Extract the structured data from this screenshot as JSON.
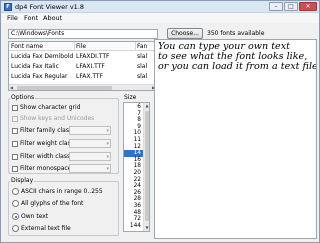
{
  "window": {
    "title": "dp4 Font Viewer v1.8",
    "icon": "app-font-icon"
  },
  "titlebar_buttons": {
    "minimize": "–",
    "maximize": "□",
    "close": "✕"
  },
  "menu": [
    "File",
    "Font",
    "About"
  ],
  "path": {
    "value": "C:\\Windows\\Fonts"
  },
  "choose_button": "Choose...",
  "fonts_available": "350 fonts available",
  "font_list": {
    "columns": [
      "Font name",
      "File",
      "Fan"
    ],
    "rows": [
      {
        "name": "Lucida Fax Demibold...",
        "file": "LFAXDI.TTF",
        "family": "slal"
      },
      {
        "name": "Lucida Fax Italic",
        "file": "LFAXI.TTF",
        "family": "slal"
      },
      {
        "name": "Lucida Fax Regular",
        "file": "LFAX.TTF",
        "family": "slal"
      }
    ]
  },
  "options": {
    "title": "Options",
    "show_grid": "Show character grid",
    "show_keys": "Show keys and Unicodes",
    "filters": [
      "Filter family class:",
      "Filter weight class:",
      "Filter width class:",
      "Filter monospaced:"
    ]
  },
  "display": {
    "title": "Display",
    "choices": [
      {
        "label": "ASCII chars in range 0..255",
        "selected": false
      },
      {
        "label": "All glyphs of the font",
        "selected": false
      },
      {
        "label": "Own text",
        "selected": true
      },
      {
        "label": "External text file",
        "selected": false
      }
    ]
  },
  "size": {
    "title": "Size",
    "items": [
      "6",
      "7",
      "8",
      "9",
      "10",
      "11",
      "12",
      "14",
      "16",
      "18",
      "20",
      "22",
      "24",
      "26",
      "28",
      "36",
      "48",
      "72",
      "144"
    ],
    "selected": "14"
  },
  "preview": {
    "lines": [
      "You can type your own text",
      "to see what the font looks like,",
      "or you can load it from a text file."
    ]
  },
  "colors": {
    "selection": "#3373c6",
    "close_button": "#c75050"
  }
}
